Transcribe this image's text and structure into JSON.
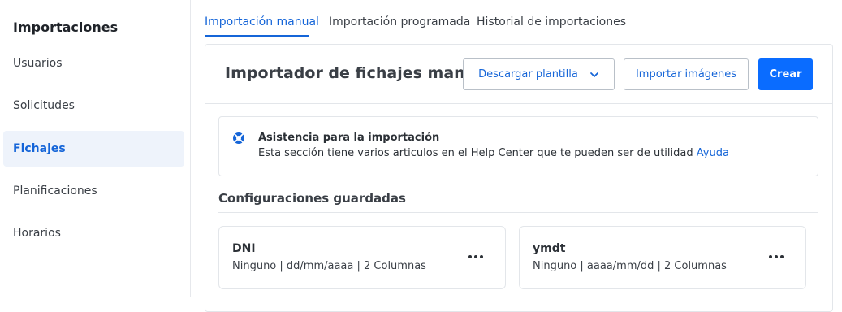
{
  "sidebar": {
    "title": "Importaciones",
    "items": [
      {
        "label": "Usuarios"
      },
      {
        "label": "Solicitudes"
      },
      {
        "label": "Fichajes"
      },
      {
        "label": "Planificaciones"
      },
      {
        "label": "Horarios"
      }
    ],
    "active_item": "Fichajes"
  },
  "tabs": [
    {
      "label": "Importación manual"
    },
    {
      "label": "Importación programada"
    },
    {
      "label": "Historial de importaciones"
    }
  ],
  "active_tab": "Importación manual",
  "header": {
    "title": "Importador de fichajes manual",
    "download_template_label": "Descargar plantilla",
    "import_images_label": "Importar imágenes",
    "create_label": "Crear"
  },
  "info": {
    "title": "Asistencia para la importación",
    "text": "Esta sección tiene varios articulos en el Help Center que te pueden ser de utilidad",
    "link_label": "Ayuda"
  },
  "saved_configs": {
    "title": "Configuraciones guardadas",
    "items": [
      {
        "name": "DNI",
        "description": "Ninguno | dd/mm/aaaa | 2 Columnas"
      },
      {
        "name": "ymdt",
        "description": "Ninguno | aaaa/mm/dd | 2 Columnas"
      }
    ]
  },
  "colors": {
    "accent": "#1565d8",
    "primary_button": "#0a6cff",
    "active_nav_bg": "#eef3fb"
  },
  "icons": {
    "download_chevron": "chevron-down-icon",
    "info": "lifebuoy-icon",
    "card_menu": "more-horizontal-icon"
  }
}
